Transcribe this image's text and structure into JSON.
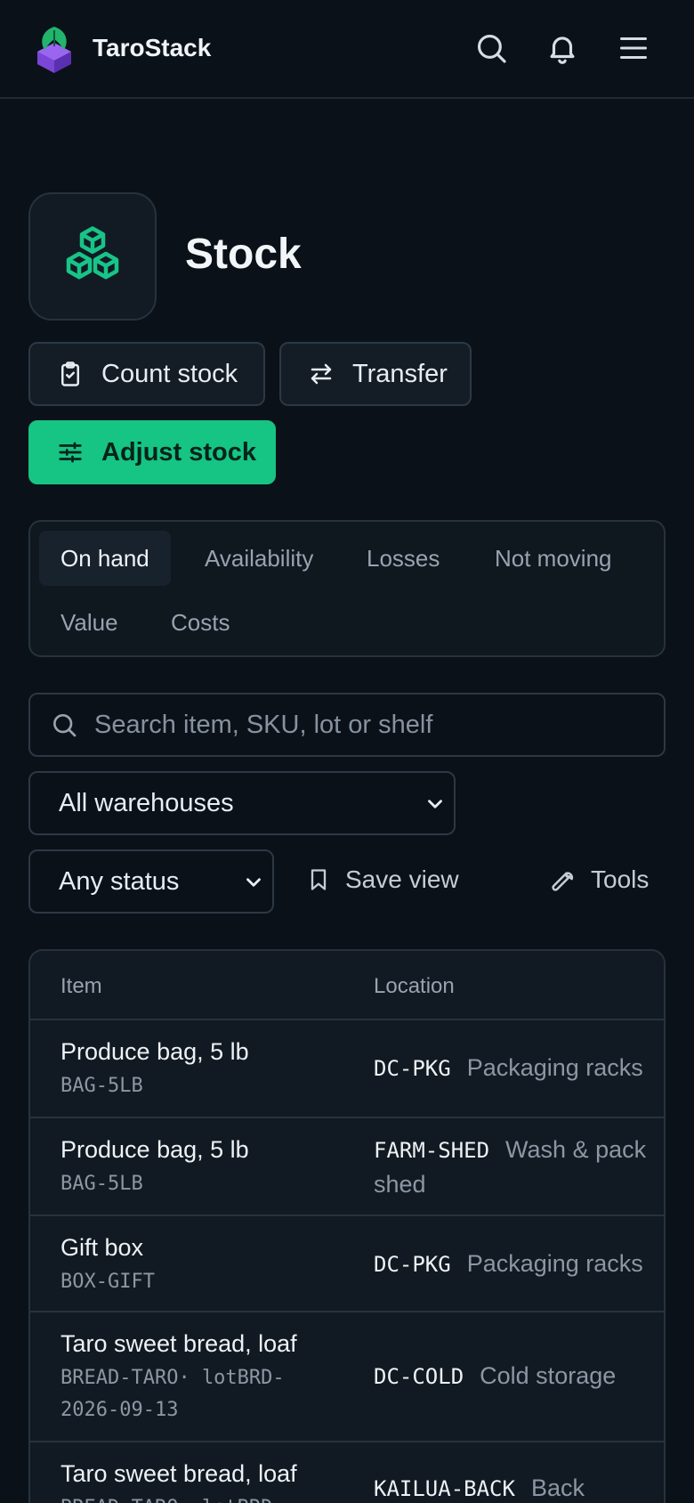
{
  "header": {
    "brand": "TaroStack",
    "icons": [
      "search-icon",
      "bell-icon",
      "menu-icon"
    ]
  },
  "page": {
    "title": "Stock",
    "icon": "cubes-icon"
  },
  "actions": {
    "count_stock": "Count stock",
    "transfer": "Transfer",
    "adjust_stock": "Adjust stock"
  },
  "tabs": [
    {
      "label": "On hand",
      "active": true
    },
    {
      "label": "Availability",
      "active": false
    },
    {
      "label": "Losses",
      "active": false
    },
    {
      "label": "Not moving",
      "active": false
    },
    {
      "label": "Value",
      "active": false
    },
    {
      "label": "Costs",
      "active": false
    }
  ],
  "filters": {
    "search_placeholder": "Search item, SKU, lot or shelf",
    "warehouse_selected": "All warehouses",
    "status_selected": "Any status",
    "save_view": "Save view",
    "tools": "Tools"
  },
  "table": {
    "columns": [
      "Item",
      "Location"
    ],
    "rows": [
      {
        "name": "Produce bag, 5 lb",
        "sku": "BAG-5LB",
        "loc_code": "DC-PKG",
        "loc_name": "Packaging racks"
      },
      {
        "name": "Produce bag, 5 lb",
        "sku": "BAG-5LB",
        "loc_code": "FARM-SHED",
        "loc_name": "Wash & pack shed"
      },
      {
        "name": "Gift box",
        "sku": "BOX-GIFT",
        "loc_code": "DC-PKG",
        "loc_name": "Packaging racks"
      },
      {
        "name": "Taro sweet bread, loaf",
        "sku": "BREAD-TARO· lotBRD-2026-09-13",
        "loc_code": "DC-COLD",
        "loc_name": "Cold storage"
      },
      {
        "name": "Taro sweet bread, loaf",
        "sku": "BREAD-TARO· lotBRD-",
        "loc_code": "KAILUA-BACK",
        "loc_name": "Back"
      }
    ]
  },
  "colors": {
    "background": "#0b1118",
    "accent": "#16c484",
    "border": "#26323e"
  }
}
